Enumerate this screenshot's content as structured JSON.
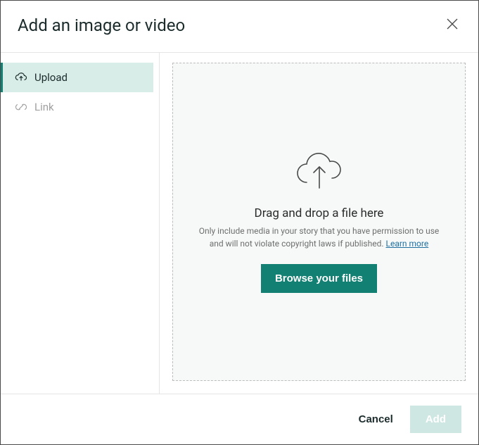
{
  "header": {
    "title": "Add an image or video"
  },
  "sidebar": {
    "tabs": [
      {
        "label": "Upload"
      },
      {
        "label": "Link"
      }
    ]
  },
  "dropzone": {
    "title": "Drag and drop a file here",
    "description": "Only include media in your story that you have permission to use and will not violate copyright laws if published. ",
    "learn_more": "Learn more",
    "browse_label": "Browse your files"
  },
  "footer": {
    "cancel": "Cancel",
    "add": "Add"
  }
}
